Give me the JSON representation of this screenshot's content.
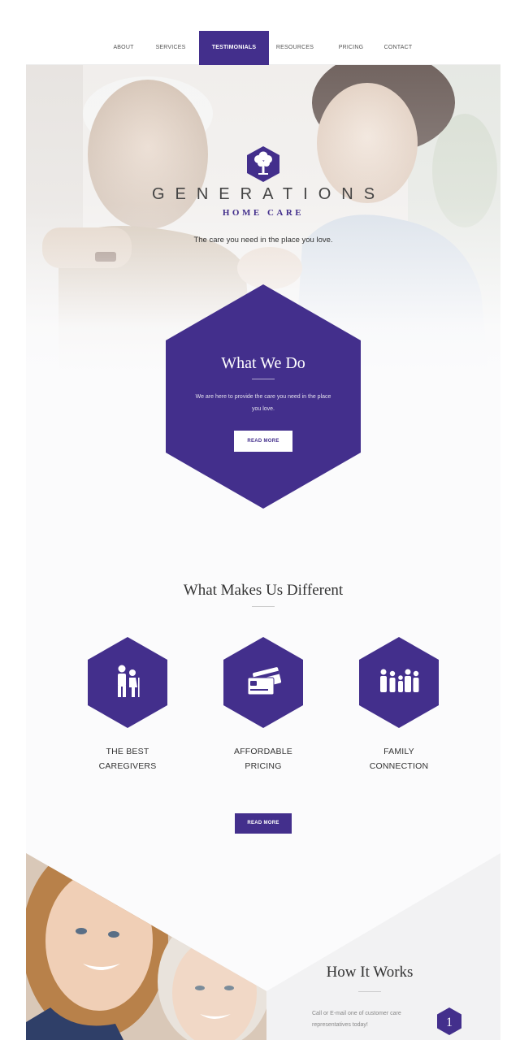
{
  "nav": {
    "items": [
      {
        "label": "ABOUT",
        "active": false
      },
      {
        "label": "SERVICES",
        "active": false
      },
      {
        "label": "TESTIMONIALS",
        "active": true
      },
      {
        "label": "RESOURCES",
        "active": false
      },
      {
        "label": "PRICING",
        "active": false
      },
      {
        "label": "CONTACT",
        "active": false
      }
    ]
  },
  "hero": {
    "logo_icon": "tree-icon",
    "brand_name": "GENERATIONS",
    "brand_sub": "HOME CARE",
    "tagline": "The care you need in the place you love."
  },
  "what_we_do": {
    "title": "What We Do",
    "text": "We are here to provide the care you need in the place you love.",
    "button": "READ MORE"
  },
  "different": {
    "title": "What Makes Us Different",
    "features": [
      {
        "icon": "caregiver-icon",
        "line1": "THE BEST",
        "line2": "CAREGIVERS"
      },
      {
        "icon": "payment-card-icon",
        "line1": "AFFORDABLE",
        "line2": "PRICING"
      },
      {
        "icon": "family-icon",
        "line1": "FAMILY",
        "line2": "CONNECTION"
      }
    ],
    "button": "READ MORE"
  },
  "how_it_works": {
    "title": "How It Works",
    "step_text": "Call or E-mail one of customer care representatives today!",
    "step_number": "1"
  },
  "colors": {
    "brand": "#432f8c",
    "background": "#fbfbfc",
    "text": "#333333"
  }
}
